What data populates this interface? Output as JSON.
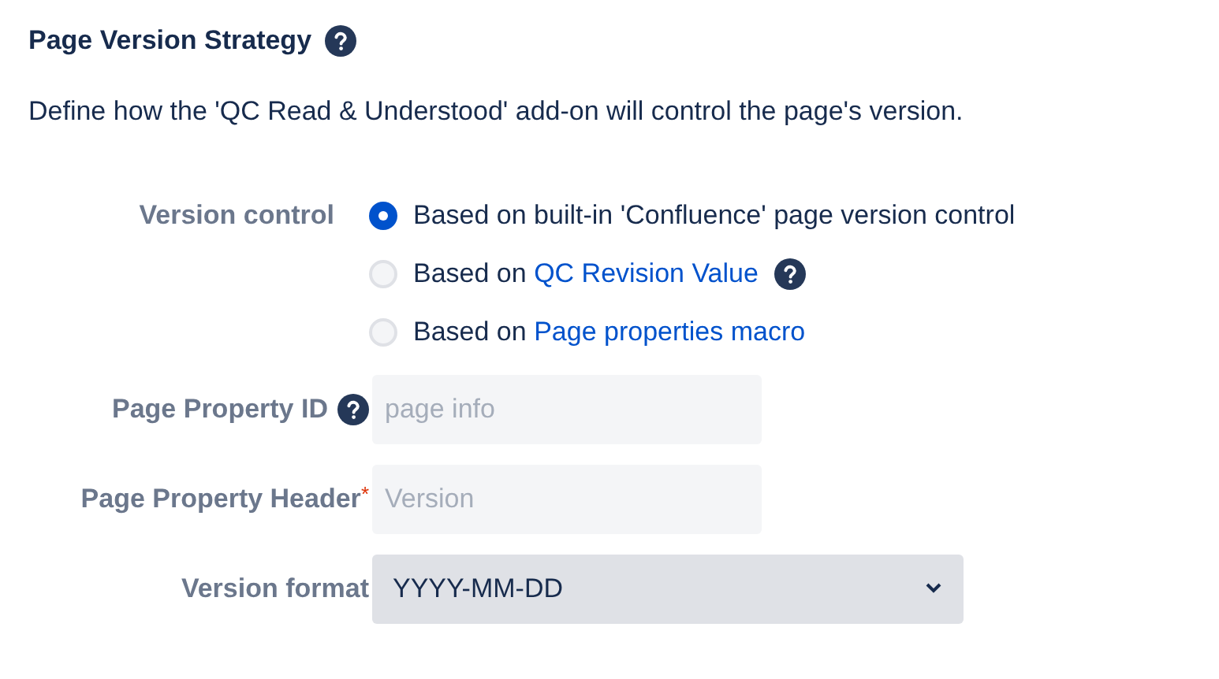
{
  "section": {
    "title": "Page Version Strategy",
    "help": true,
    "description": "Define how the 'QC Read & Understood' add-on will control the page's version."
  },
  "version_control": {
    "label": "Version control",
    "options": [
      {
        "text": "Based on built-in 'Confluence' page version control",
        "selected": true,
        "help": false
      },
      {
        "text": "Based on",
        "link": "QC Revision Value",
        "selected": false,
        "help": true
      },
      {
        "text": "Based on",
        "link": "Page properties macro",
        "selected": false,
        "help": false
      }
    ]
  },
  "fields": [
    {
      "kind": "text",
      "label": "Page Property ID",
      "help": true,
      "placeholder": "page info"
    },
    {
      "kind": "text",
      "label": "Page Property Header",
      "help": false,
      "required_mark": "*",
      "placeholder": "Version"
    },
    {
      "kind": "select",
      "label": "Version format",
      "help": false,
      "value": "YYYY-MM-DD"
    }
  ]
}
